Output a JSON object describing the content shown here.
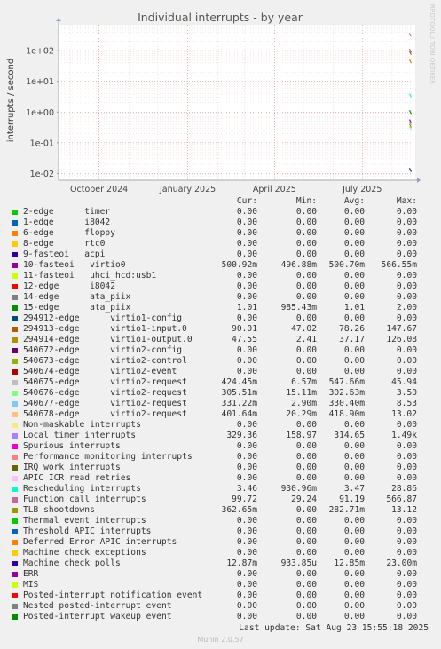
{
  "chart_data": {
    "type": "line",
    "title": "Individual interrupts - by year",
    "ylabel": "interrupts / second",
    "y_scale": "log",
    "ylim": [
      0.006,
      700
    ],
    "y_ticks": [
      {
        "value": 0.01,
        "label": "1e-02"
      },
      {
        "value": 0.1,
        "label": "1e-01"
      },
      {
        "value": 1,
        "label": "1e+00"
      },
      {
        "value": 10,
        "label": "1e+01"
      },
      {
        "value": 100,
        "label": "1e+02"
      }
    ],
    "xlim": [
      "2024-08-20",
      "2025-08-25"
    ],
    "x_ticks": [
      {
        "date": "2024-10-01",
        "label": "October 2024"
      },
      {
        "date": "2025-01-01",
        "label": "January 2025"
      },
      {
        "date": "2025-04-01",
        "label": "April 2025"
      },
      {
        "date": "2025-07-01",
        "label": "July 2025"
      }
    ],
    "grid": true,
    "watermark": "RRDTOOL / TOBI OETIKER",
    "columns": [
      "Cur:",
      "Min:",
      "Avg:",
      "Max:"
    ],
    "series": [
      {
        "name": "2-edge      timer",
        "color": "#00cc00",
        "values": [
          "0.00",
          "0.00",
          "0.00",
          "0.00"
        ]
      },
      {
        "name": "1-edge      i8042",
        "color": "#0066b3",
        "values": [
          "0.00",
          "0.00",
          "0.00",
          "0.00"
        ]
      },
      {
        "name": "6-edge      floppy",
        "color": "#ff8000",
        "values": [
          "0.00",
          "0.00",
          "0.00",
          "0.00"
        ]
      },
      {
        "name": "8-edge      rtc0",
        "color": "#ffcc00",
        "values": [
          "0.00",
          "0.00",
          "0.00",
          "0.00"
        ]
      },
      {
        "name": "9-fasteoi   acpi",
        "color": "#330099",
        "values": [
          "0.00",
          "0.00",
          "0.00",
          "0.00"
        ]
      },
      {
        "name": "10-fasteoi   virtio0",
        "color": "#990099",
        "values": [
          "500.92m",
          "496.88m",
          "500.70m",
          "566.55m"
        ]
      },
      {
        "name": "11-fasteoi   uhci_hcd:usb1",
        "color": "#ccff00",
        "values": [
          "0.00",
          "0.00",
          "0.00",
          "0.00"
        ]
      },
      {
        "name": "12-edge      i8042",
        "color": "#ff0000",
        "values": [
          "0.00",
          "0.00",
          "0.00",
          "0.00"
        ]
      },
      {
        "name": "14-edge      ata_piix",
        "color": "#808080",
        "values": [
          "0.00",
          "0.00",
          "0.00",
          "0.00"
        ]
      },
      {
        "name": "15-edge      ata_piix",
        "color": "#008f00",
        "values": [
          "1.01",
          "985.43m",
          "1.01",
          "2.00"
        ]
      },
      {
        "name": "294912-edge      virtio1-config",
        "color": "#00487d",
        "values": [
          "0.00",
          "0.00",
          "0.00",
          "0.00"
        ]
      },
      {
        "name": "294913-edge      virtio1-input.0",
        "color": "#b35a00",
        "values": [
          "90.01",
          "47.02",
          "78.26",
          "147.67"
        ]
      },
      {
        "name": "294914-edge      virtio1-output.0",
        "color": "#b38f00",
        "values": [
          "47.55",
          "2.41",
          "37.17",
          "126.08"
        ]
      },
      {
        "name": "540672-edge      virtio2-config",
        "color": "#6b006b",
        "values": [
          "0.00",
          "0.00",
          "0.00",
          "0.00"
        ]
      },
      {
        "name": "540673-edge      virtio2-control",
        "color": "#8fb300",
        "values": [
          "0.00",
          "0.00",
          "0.00",
          "0.00"
        ]
      },
      {
        "name": "540674-edge      virtio2-event",
        "color": "#b30000",
        "values": [
          "0.00",
          "0.00",
          "0.00",
          "0.00"
        ]
      },
      {
        "name": "540675-edge      virtio2-request",
        "color": "#bebebe",
        "values": [
          "424.45m",
          "6.57m",
          "547.66m",
          "45.94"
        ]
      },
      {
        "name": "540676-edge      virtio2-request",
        "color": "#80ff80",
        "values": [
          "305.51m",
          "15.11m",
          "302.63m",
          "3.50"
        ]
      },
      {
        "name": "540677-edge      virtio2-request",
        "color": "#80c9ff",
        "values": [
          "331.22m",
          "2.90m",
          "330.40m",
          "8.53"
        ]
      },
      {
        "name": "540678-edge      virtio2-request",
        "color": "#ffc080",
        "values": [
          "401.64m",
          "20.29m",
          "418.90m",
          "13.02"
        ]
      },
      {
        "name": "Non-maskable interrupts",
        "color": "#ffe680",
        "values": [
          "0.00",
          "0.00",
          "0.00",
          "0.00"
        ]
      },
      {
        "name": "Local timer interrupts",
        "color": "#aa80ff",
        "values": [
          "329.36",
          "158.97",
          "314.65",
          "1.49k"
        ]
      },
      {
        "name": "Spurious interrupts",
        "color": "#ee00cc",
        "values": [
          "0.00",
          "0.00",
          "0.00",
          "0.00"
        ]
      },
      {
        "name": "Performance monitoring interrupts",
        "color": "#ff8080",
        "values": [
          "0.00",
          "0.00",
          "0.00",
          "0.00"
        ]
      },
      {
        "name": "IRQ work interrupts",
        "color": "#666600",
        "values": [
          "0.00",
          "0.00",
          "0.00",
          "0.00"
        ]
      },
      {
        "name": "APIC ICR read retries",
        "color": "#ffbfff",
        "values": [
          "0.00",
          "0.00",
          "0.00",
          "0.00"
        ]
      },
      {
        "name": "Rescheduling interrupts",
        "color": "#00ffcc",
        "values": [
          "3.46",
          "930.96m",
          "3.47",
          "28.86"
        ]
      },
      {
        "name": "Function call interrupts",
        "color": "#cc6699",
        "values": [
          "99.72",
          "29.24",
          "91.19",
          "566.87"
        ]
      },
      {
        "name": "TLB shootdowns",
        "color": "#999900",
        "values": [
          "362.65m",
          "0.00",
          "282.71m",
          "13.12"
        ]
      },
      {
        "name": "Thermal event interrupts",
        "color": "#00cc00",
        "values": [
          "0.00",
          "0.00",
          "0.00",
          "0.00"
        ]
      },
      {
        "name": "Threshold APIC interrupts",
        "color": "#0066b3",
        "values": [
          "0.00",
          "0.00",
          "0.00",
          "0.00"
        ]
      },
      {
        "name": "Deferred Error APIC interrupts",
        "color": "#ff8000",
        "values": [
          "0.00",
          "0.00",
          "0.00",
          "0.00"
        ]
      },
      {
        "name": "Machine check exceptions",
        "color": "#ffcc00",
        "values": [
          "0.00",
          "0.00",
          "0.00",
          "0.00"
        ]
      },
      {
        "name": "Machine check polls",
        "color": "#330099",
        "values": [
          "12.87m",
          "933.85u",
          "12.85m",
          "23.00m"
        ]
      },
      {
        "name": "ERR",
        "color": "#990099",
        "values": [
          "0.00",
          "0.00",
          "0.00",
          "0.00"
        ]
      },
      {
        "name": "MIS",
        "color": "#ccff00",
        "values": [
          "0.00",
          "0.00",
          "0.00",
          "0.00"
        ]
      },
      {
        "name": "Posted-interrupt notification event",
        "color": "#ff0000",
        "values": [
          "0.00",
          "0.00",
          "0.00",
          "0.00"
        ]
      },
      {
        "name": "Nested posted-interrupt event",
        "color": "#808080",
        "values": [
          "0.00",
          "0.00",
          "0.00",
          "0.00"
        ]
      },
      {
        "name": "Posted-interrupt wakeup event",
        "color": "#008f00",
        "values": [
          "0.00",
          "0.00",
          "0.00",
          "0.00"
        ]
      }
    ],
    "recent_marks": [
      {
        "date": "2025-08-19",
        "y": 330,
        "color": "#aa80ff"
      },
      {
        "date": "2025-08-19",
        "y": 100,
        "color": "#cc6699"
      },
      {
        "date": "2025-08-19",
        "y": 85,
        "color": "#b35a00"
      },
      {
        "date": "2025-08-19",
        "y": 45,
        "color": "#b38f00"
      },
      {
        "date": "2025-08-19",
        "y": 3.5,
        "color": "#00ffcc"
      },
      {
        "date": "2025-08-19",
        "y": 1.0,
        "color": "#008f00"
      },
      {
        "date": "2025-08-19",
        "y": 0.5,
        "color": "#990099"
      },
      {
        "date": "2025-08-19",
        "y": 0.42,
        "color": "#bebebe"
      },
      {
        "date": "2025-08-19",
        "y": 0.3,
        "color": "#80ff80"
      },
      {
        "date": "2025-08-19",
        "y": 0.36,
        "color": "#999900"
      },
      {
        "date": "2025-08-19",
        "y": 0.013,
        "color": "#330099"
      }
    ]
  },
  "footer": {
    "last_update": "Last update: Sat Aug 23 15:55:18 2025",
    "generator": "Munin 2.0.57"
  }
}
